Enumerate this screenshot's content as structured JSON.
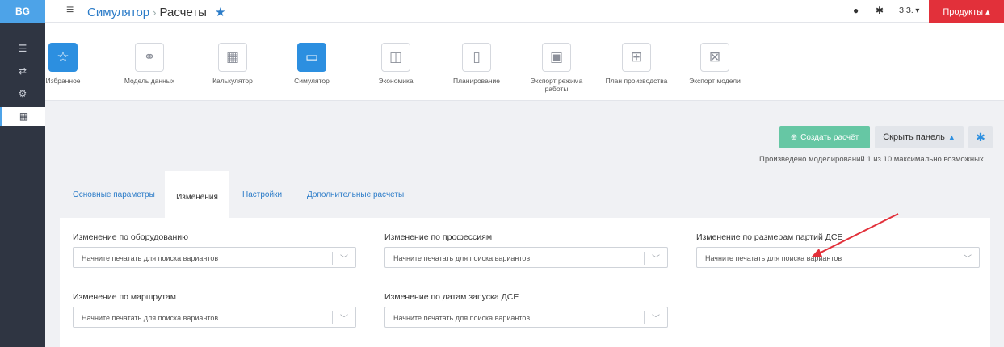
{
  "app": {
    "logo": "BG",
    "breadcrumb_root": "Симулятор",
    "breadcrumb_sep": "›",
    "breadcrumb_current": "Расчеты",
    "user": "З З. ▾",
    "products": "Продукты ▴"
  },
  "sidebar": {
    "items": [
      {
        "icon": "list-icon",
        "glyph": "☰"
      },
      {
        "icon": "swap-icon",
        "glyph": "⇄"
      },
      {
        "icon": "gears-icon",
        "glyph": "⚙"
      },
      {
        "icon": "calculator-icon",
        "glyph": "▦"
      }
    ]
  },
  "toolbar": {
    "items": [
      {
        "label": "Избранное",
        "icon": "star-icon",
        "glyph": "☆"
      },
      {
        "label": "Модель данных",
        "icon": "data-model-icon",
        "glyph": "⚭"
      },
      {
        "label": "Калькулятор",
        "icon": "calculator-icon",
        "glyph": "▦"
      },
      {
        "label": "Симулятор",
        "icon": "simulator-icon",
        "glyph": "▭"
      },
      {
        "label": "Экономика",
        "icon": "wallet-icon",
        "glyph": "◫"
      },
      {
        "label": "Планирование",
        "icon": "planning-icon",
        "glyph": "▯"
      },
      {
        "label": "Экспорт режима работы",
        "icon": "save-icon",
        "glyph": "▣"
      },
      {
        "label": "План производства",
        "icon": "calendar-plus-icon",
        "glyph": "⊞"
      },
      {
        "label": "Экспорт модели",
        "icon": "excel-icon",
        "glyph": "⊠"
      }
    ]
  },
  "actions": {
    "create": "Создать расчёт",
    "hide_panel": "Скрыть панель",
    "info": "Произведено моделирований 1 из 10 максимально возможных"
  },
  "tabs": {
    "main": "Основные параметры",
    "changes": "Изменения",
    "settings": "Настройки",
    "extra": "Дополнительные расчеты"
  },
  "fields": {
    "equipment": "Изменение по оборудованию",
    "professions": "Изменение по профессиям",
    "batch_sizes": "Изменение по размерам партий ДСЕ",
    "routes": "Изменение по маршрутам",
    "launch_dates": "Изменение по датам запуска ДСЕ",
    "placeholder": "Начните печатать для поиска вариантов"
  },
  "colors": {
    "accent": "#2c8fe0",
    "create_button": "#66c7a4",
    "products_button": "#e2303a",
    "sidebar": "#2f3542",
    "annotation_arrow": "#e2303a"
  }
}
